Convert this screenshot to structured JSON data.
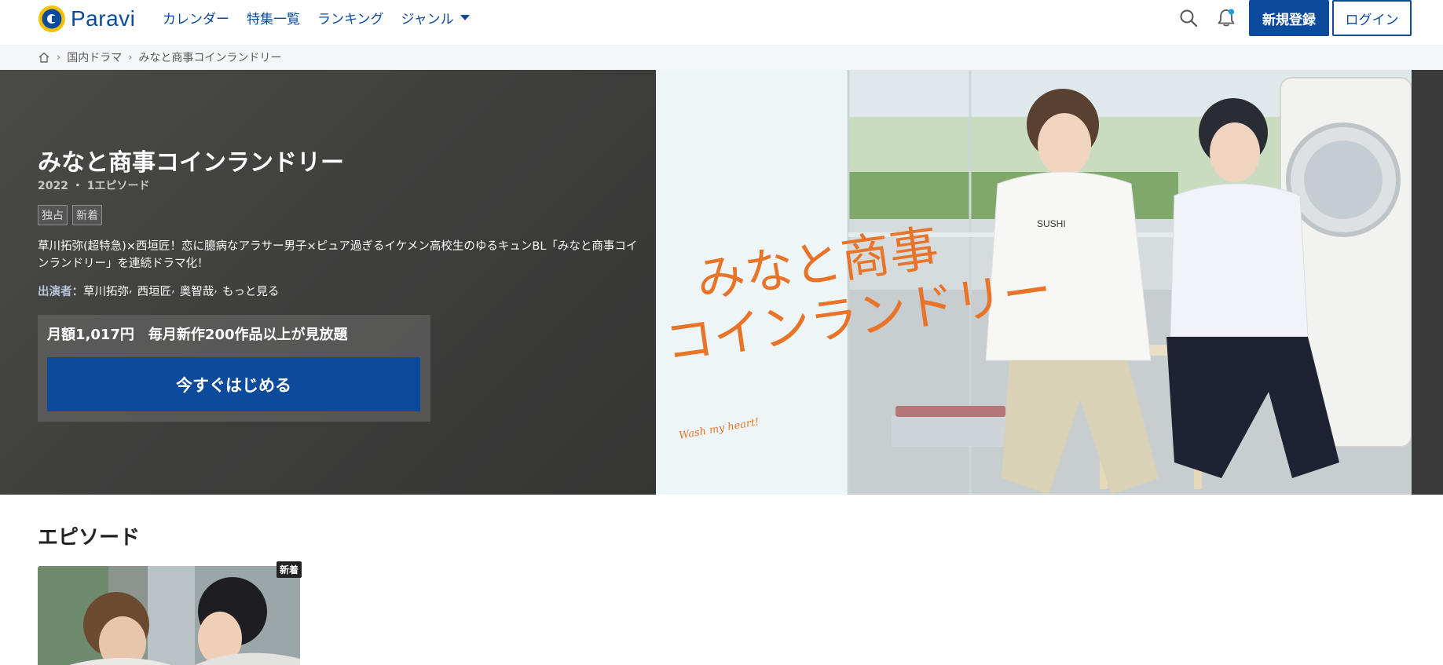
{
  "header": {
    "logo_text": "Paravi",
    "nav": [
      {
        "label": "カレンダー"
      },
      {
        "label": "特集一覧"
      },
      {
        "label": "ランキング"
      },
      {
        "label": "ジャンル"
      }
    ],
    "register_label": "新規登録",
    "login_label": "ログイン"
  },
  "breadcrumb": {
    "items": [
      "国内ドラマ",
      "みなと商事コインランドリー"
    ]
  },
  "hero": {
    "title": "みなと商事コインランドリー",
    "meta": "2022 ・ 1エピソード",
    "tags": [
      "独占",
      "新着"
    ],
    "description": "草川拓弥(超特急)×西垣匠！恋に臆病なアラサー男子×ピュア過ぎるイケメン高校生のゆるキュンBL「みなと商事コインランドリー」を連続ドラマ化！",
    "cast_label": "出演者：",
    "cast": [
      "草川拓弥",
      "西垣匠",
      "奥智哉"
    ],
    "cast_more": "もっと見る",
    "plan_text": "月額1,017円　毎月新作200作品以上が見放題",
    "cta_label": "今すぐはじめる",
    "art_title_line1": "みなと商事",
    "art_title_line2": "コインランドリー",
    "art_subtitle": "Wash my heart!",
    "art_shirt_text": "SUSHI"
  },
  "episodes": {
    "section_title": "エピソード",
    "items": [
      {
        "badge": "新着"
      }
    ]
  },
  "colors": {
    "brand": "#0c4a9c",
    "logo_yellow": "#f2c200",
    "notification_dot": "#1e9be0",
    "art_orange": "#e8742a"
  }
}
